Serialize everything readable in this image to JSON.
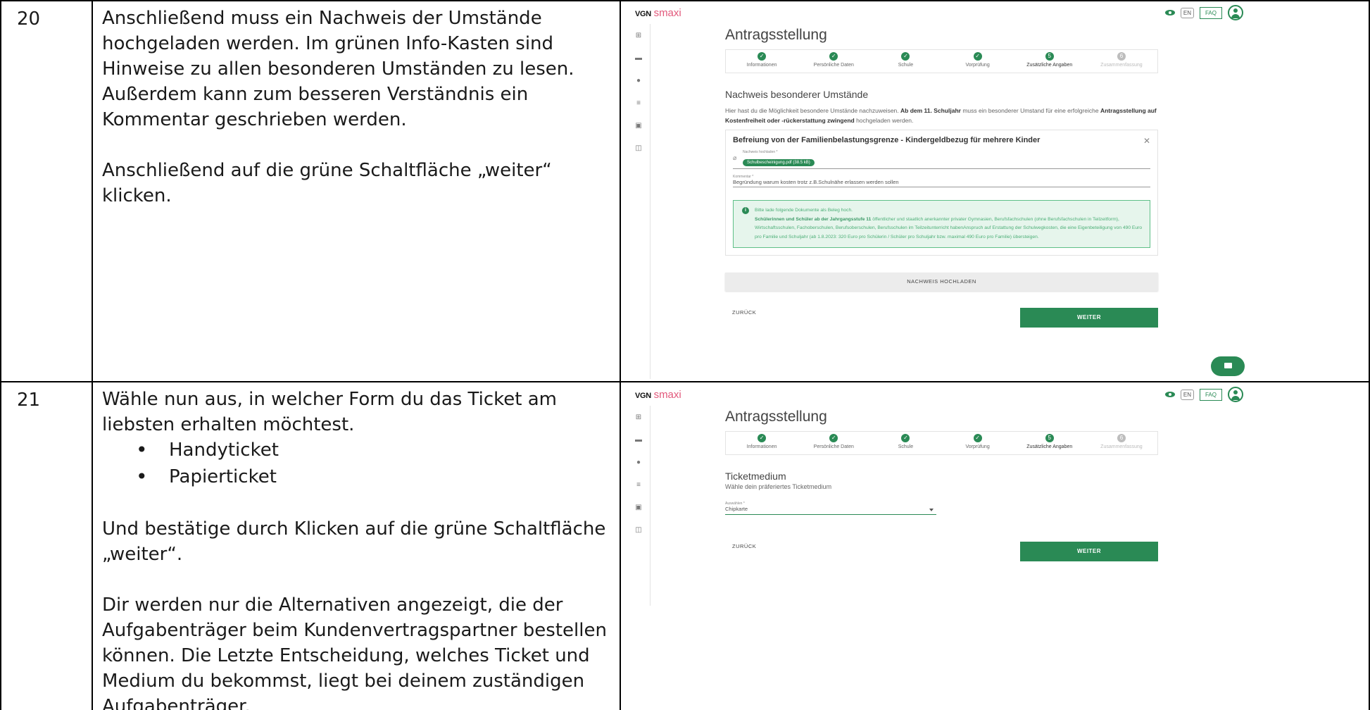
{
  "rows": [
    {
      "number": "20",
      "paragraphs": [
        "Anschließend muss ein Nachweis der Umstände hochgeladen werden. Im grünen Info-Kasten sind Hinweise zu allen besonderen Umständen zu lesen. Außerdem kann zum besseren Verständnis ein Kommentar geschrieben werden.",
        "Anschließend auf die grüne Schaltfläche „weiter“ klicken."
      ]
    },
    {
      "number": "21",
      "intro": "Wähle nun aus, in welcher Form du das Ticket am liebsten erhalten möchtest.",
      "bullets": [
        "Handyticket",
        "Papierticket"
      ],
      "paragraphs": [
        "Und bestätige durch Klicken auf die grüne Schaltfläche „weiter“.",
        "Dir werden nur die Alternativen angezeigt, die der Aufgabenträger beim Kundenvertragspartner bestellen können. Die Letzte Entscheidung, welches Ticket und Medium du bekommst, liegt bei deinem zuständigen Aufgabenträger."
      ]
    }
  ],
  "app": {
    "brand_vgn": "VGN",
    "brand_smaxi": "smaxi",
    "lang": "EN",
    "faq": "FAQ",
    "page_title": "Antragsstellung",
    "steps": [
      {
        "label": "Informationen",
        "dot": "✓"
      },
      {
        "label": "Persönliche Daten",
        "dot": "✓"
      },
      {
        "label": "Schule",
        "dot": "✓"
      },
      {
        "label": "Vorprüfung",
        "dot": "✓"
      },
      {
        "label": "Zusätzliche Angaben",
        "dot": "5"
      },
      {
        "label": "Zusammenfassung",
        "dot": "6"
      }
    ],
    "back": "ZURÜCK",
    "next": "WEITER"
  },
  "shot1": {
    "section_title": "Nachweis besonderer Umstände",
    "desc_part1": "Hier hast du die Möglichkeit besondere Umstände nachzuweisen. ",
    "desc_bold1": "Ab dem 11. Schuljahr",
    "desc_part2": " muss ein besonderer Umstand für eine erfolgreiche ",
    "desc_bold2": "Antragsstellung auf Kostenfreiheit oder -rückerstattung zwingend",
    "desc_part3": " hochgeladen werden.",
    "card_title": "Befreiung von der Familienbelastungsgrenze - Kindergeldbezug für mehrere Kinder",
    "upload_label": "Nachweis hochladen *",
    "file_chip": "Schulbescheinigung.pdf (38.5 kB)",
    "comment_label": "Kommentar *",
    "comment_value": "Begründung warum kosten trotz z.B.Schulnähe erlassen werden sollen",
    "info_line1": "Bitte lade folgende Dokumente als Beleg hoch.",
    "info_bold": "Schülerinnen und Schüler ab der Jahrgangsstufe 11",
    "info_rest": " öffentlicher und staatlich anerkannter privater Gymnasien, Berufsfachschulen (ohne Berufsfachschulen in Teilzeitform), Wirtschaftsschulen, Fachoberschulen, Berufsoberschulen, Berufsschulen im Teilzeitunterricht habenAnspruch auf Erstattung der Schulwegkosten, die eine Eigenbeteiligung von 490 Euro pro Familie und Schuljahr (ab 1.8.2023: 320 Euro pro Schülerin / Schüler pro Schuljahr bzw. maximal 490 Euro pro Familie) übersteigen.",
    "upload_button": "NACHWEIS HOCHLADEN"
  },
  "shot2": {
    "section_title": "Ticketmedium",
    "section_sub": "Wähle dein präferiertes Ticketmedium",
    "select_label": "Auswählen *",
    "select_value": "Chipkarte"
  },
  "icons": {
    "sidebar": [
      "dashboard-icon",
      "folder-icon",
      "person-icon",
      "person-list-icon",
      "document-icon",
      "chat-icon"
    ]
  }
}
